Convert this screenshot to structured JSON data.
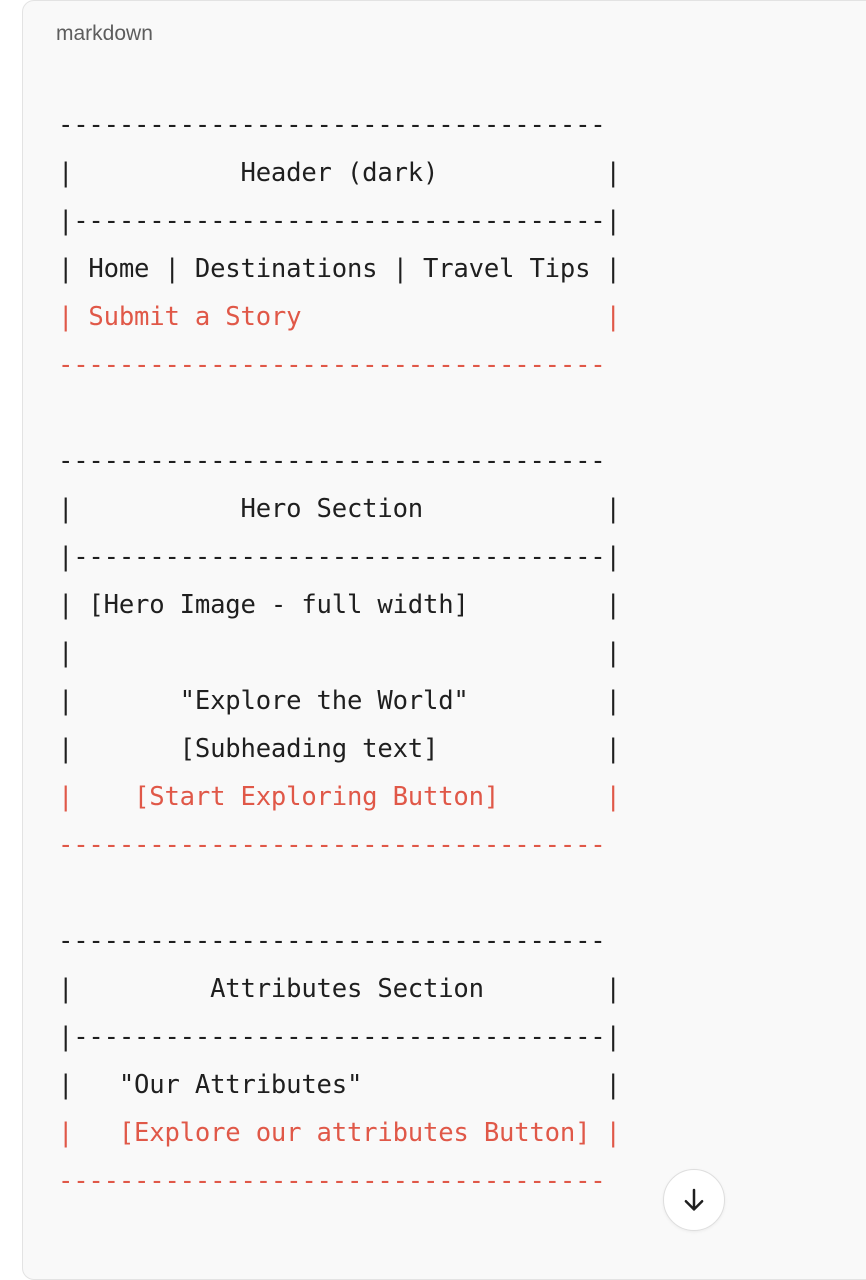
{
  "code_block": {
    "language_label": "markdown",
    "lines": [
      {
        "text": "------------------------------------",
        "highlight": false
      },
      {
        "text": "|           Header (dark)           |",
        "highlight": false
      },
      {
        "text": "|-----------------------------------|",
        "highlight": false
      },
      {
        "text": "| Home | Destinations | Travel Tips |",
        "highlight": false
      },
      {
        "text": "| Submit a Story                    |",
        "highlight": true
      },
      {
        "text": "------------------------------------",
        "highlight": true
      },
      {
        "text": "",
        "highlight": false
      },
      {
        "text": "------------------------------------",
        "highlight": false
      },
      {
        "text": "|           Hero Section            |",
        "highlight": false
      },
      {
        "text": "|-----------------------------------|",
        "highlight": false
      },
      {
        "text": "| [Hero Image - full width]         |",
        "highlight": false
      },
      {
        "text": "|                                   |",
        "highlight": false
      },
      {
        "text": "|       \"Explore the World\"         |",
        "highlight": false
      },
      {
        "text": "|       [Subheading text]           |",
        "highlight": false
      },
      {
        "text": "|    [Start Exploring Button]       |",
        "highlight": true
      },
      {
        "text": "------------------------------------",
        "highlight": true
      },
      {
        "text": "",
        "highlight": false
      },
      {
        "text": "------------------------------------",
        "highlight": false
      },
      {
        "text": "|         Attributes Section        |",
        "highlight": false
      },
      {
        "text": "|-----------------------------------|",
        "highlight": false
      },
      {
        "text": "|   \"Our Attributes\"                |",
        "highlight": false
      },
      {
        "text": "|   [Explore our attributes Button] |",
        "highlight": true
      },
      {
        "text": "------------------------------------",
        "highlight": true
      }
    ]
  },
  "scroll_button": {
    "icon": "arrow-down-icon"
  },
  "colors": {
    "highlight_text": "#e05848",
    "normal_text": "#1f1f1f",
    "block_background": "#f9f9f9"
  }
}
